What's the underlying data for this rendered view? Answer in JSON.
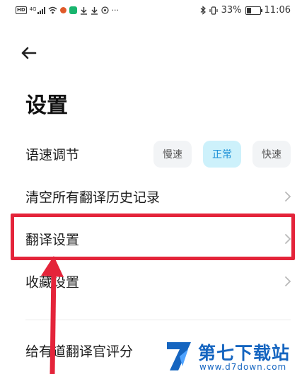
{
  "status_bar": {
    "hd_label": "HD",
    "network_label": "4G",
    "bluetooth_icon": "bluetooth-icon",
    "vibrate_icon": "vibrate-icon",
    "battery_percent": "33%",
    "battery_level": 0.33,
    "time": "11:06",
    "more_label": "···"
  },
  "header": {
    "back_icon": "arrow-left-icon",
    "title": "设置"
  },
  "settings": {
    "speech_speed": {
      "label": "语速调节",
      "options": [
        "慢速",
        "正常",
        "快速"
      ],
      "selected": "正常"
    },
    "clear_history_label": "清空所有翻译历史记录",
    "translation_settings_label": "翻译设置",
    "favorites_settings_label": "收藏设置",
    "rate_app_label": "给有道翻译官评分"
  },
  "annotation": {
    "highlight_color": "#e4243a"
  },
  "watermark": {
    "name": "第七下载站",
    "url": "www.d7down.com",
    "color": "#1565c0"
  },
  "colors": {
    "accent": "#1a8fd6",
    "active_chip_bg": "#cdf1fb",
    "chip_bg": "#f2f4f6"
  }
}
